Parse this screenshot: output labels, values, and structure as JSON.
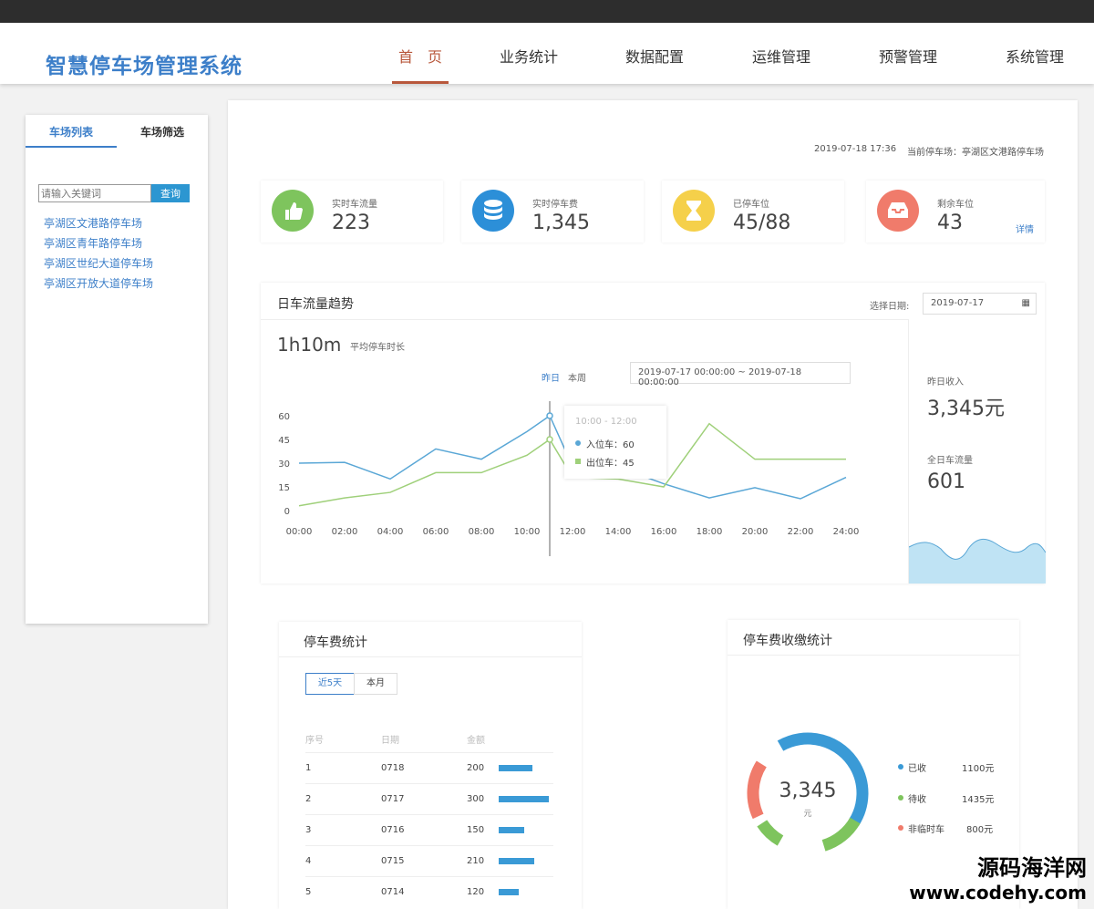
{
  "header": {
    "logo": "智慧停车场管理系统",
    "nav": [
      "首　页",
      "业务统计",
      "数据配置",
      "运维管理",
      "预警管理",
      "系统管理"
    ]
  },
  "sidebar": {
    "tabs": [
      "车场列表",
      "车场筛选"
    ],
    "search_placeholder": "请输入关键词",
    "search_button": "查询",
    "lots": [
      "亭湖区文港路停车场",
      "亭湖区青年路停车场",
      "亭湖区世纪大道停车场",
      "亭湖区开放大道停车场"
    ]
  },
  "meta": {
    "datetime": "2019-07-18 17:36",
    "current_lot": "当前停车场：亭湖区文港路停车场"
  },
  "stats": [
    {
      "label": "实时车流量",
      "value": "223",
      "color": "#7ec45d",
      "icon": "thumbs-up-icon"
    },
    {
      "label": "实时停车费",
      "value": "1,345",
      "color": "#2c8fd8",
      "icon": "database-icon"
    },
    {
      "label": "已停车位",
      "value": "45/88",
      "color": "#f5d04a",
      "icon": "hourglass-icon"
    },
    {
      "label": "剩余车位",
      "value": "43",
      "color": "#f07b6b",
      "icon": "inbox-icon"
    }
  ],
  "detail_link": "详情",
  "trend": {
    "title": "日车流量趋势",
    "date_label": "选择日期:",
    "date_value": "2019-07-17",
    "avg_value": "1h10m",
    "avg_label": "平均停车时长",
    "toggle": [
      "昨日",
      "本周"
    ],
    "range": "2019-07-17 00:00:00 ~ 2019-07-18 00:00:00",
    "tooltip": {
      "title": "10:00 - 12:00",
      "in": "入位车：60",
      "out": "出位车：45"
    },
    "side": {
      "income_label": "昨日收入",
      "income_value": "3,345元",
      "flow_label": "全日车流量",
      "flow_value": "601"
    }
  },
  "chart_data": {
    "type": "line",
    "x": [
      "00:00",
      "02:00",
      "04:00",
      "06:00",
      "08:00",
      "10:00",
      "11:00",
      "12:00",
      "14:00",
      "16:00",
      "18:00",
      "20:00",
      "22:00",
      "24:00"
    ],
    "x_ticks": [
      "00:00",
      "02:00",
      "04:00",
      "06:00",
      "08:00",
      "10:00",
      "12:00",
      "14:00",
      "16:00",
      "18:00",
      "20:00",
      "22:00",
      "24:00"
    ],
    "y_ticks": [
      "0",
      "15",
      "30",
      "45",
      "60"
    ],
    "ylim": [
      0,
      60
    ],
    "series": [
      {
        "name": "入位车",
        "color": "#5aa7d6",
        "values": [
          30,
          30.5,
          20,
          39,
          32.5,
          50,
          60,
          28,
          27.5,
          17,
          8,
          14.5,
          7.5,
          21
        ]
      },
      {
        "name": "出位车",
        "color": "#9fd07a",
        "values": [
          3,
          8,
          11.5,
          24,
          24,
          35,
          45,
          21,
          20,
          15,
          55,
          32.5,
          32.5,
          32.5
        ]
      }
    ]
  },
  "fees": {
    "title": "停车费统计",
    "tabs": [
      "近5天",
      "本月"
    ],
    "headers": [
      "序号",
      "日期",
      "金额"
    ],
    "rows": [
      {
        "idx": "1",
        "date": "0718",
        "amount": "200",
        "value": 200
      },
      {
        "idx": "2",
        "date": "0717",
        "amount": "300",
        "value": 300
      },
      {
        "idx": "3",
        "date": "0716",
        "amount": "150",
        "value": 150
      },
      {
        "idx": "4",
        "date": "0715",
        "amount": "210",
        "value": 210
      },
      {
        "idx": "5",
        "date": "0714",
        "amount": "120",
        "value": 120
      }
    ]
  },
  "collection": {
    "title": "停车费收缴统计",
    "total": "3,345",
    "unit": "元",
    "legend": [
      {
        "name": "已收",
        "amount": "1100元",
        "color": "#3a9ad6"
      },
      {
        "name": "待收",
        "amount": "1435元",
        "color": "#7ec45d"
      },
      {
        "name": "非临时车",
        "amount": "800元",
        "color": "#f07b6b"
      }
    ]
  },
  "watermark": {
    "line1": "源码海洋网",
    "line2": "www.codehy.com"
  }
}
